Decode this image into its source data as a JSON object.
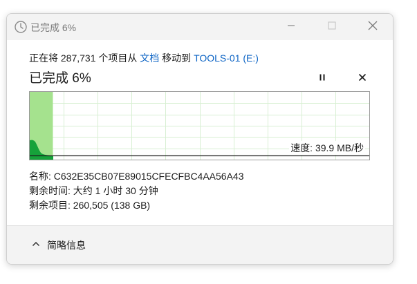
{
  "window": {
    "title": "已完成 6%",
    "min_label": "",
    "max_label": "",
    "close_label": ""
  },
  "transfer": {
    "prefix": "正在将 287,731 个项目从 ",
    "source": "文档",
    "middle": " 移动到 ",
    "destination": "TOOLS-01 (E:)",
    "progress_text": "已完成 6%",
    "progress_percent": 6,
    "speed": "速度: 39.9 MB/秒"
  },
  "details": {
    "name_label": "名称: ",
    "name_value": "C632E35CB07E89015CFECFBC4AA56A43",
    "time_label": "剩余时间: ",
    "time_value": "大约 1 小时 30 分钟",
    "items_label": "剩余项目: ",
    "items_value": "260,505 (138 GB)"
  },
  "footer": {
    "toggle_label": "简略信息"
  },
  "colors": {
    "accent_link": "#0b63c4",
    "graph_fill": "#a5e28e",
    "graph_area": "#16a23a",
    "graph_grid": "#d8efd3"
  }
}
